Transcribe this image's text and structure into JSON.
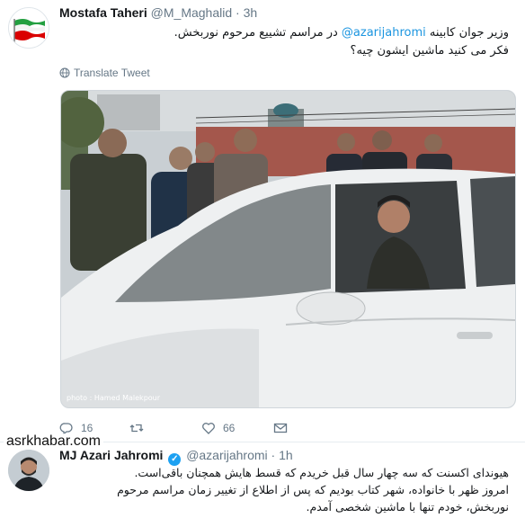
{
  "tweet1": {
    "name": "Mostafa Taheri",
    "handle": "@M_Maghalid",
    "separator": "·",
    "time": "3h",
    "text_line1_before": "وزیر جوان کابینه ",
    "text_mention": "@azarijahromi",
    "text_line1_after": " در مراسم تشییع مرحوم نوربخش.",
    "text_line2": "فکر می کنید ماشین ایشون چیه؟",
    "translate_label": "Translate Tweet",
    "photo_credit": "photo : Hamed Malekpour",
    "actions": {
      "reply_count": "16",
      "retweet_count": "",
      "like_count": "66"
    }
  },
  "tweet2": {
    "name": "MJ Azari Jahromi",
    "verified_mark": "✓",
    "handle": "@azarijahromi",
    "separator": "·",
    "time": "1h",
    "line1": "هیوندای اکسنت که سه چهار سال قبل خریدم که قسط هایش همچنان باقی‌است.",
    "line2": "امروز ظهر با خانواده، شهر کتاب بودیم که پس از اطلاع از تغییر زمان مراسم مرحوم",
    "line3": "نوربخش، خودم تنها با ماشین شخصی آمدم."
  },
  "watermark": "asrkhabar.com",
  "colors": {
    "link": "#1b95e0",
    "muted": "#657786",
    "verified": "#1da1f2"
  }
}
